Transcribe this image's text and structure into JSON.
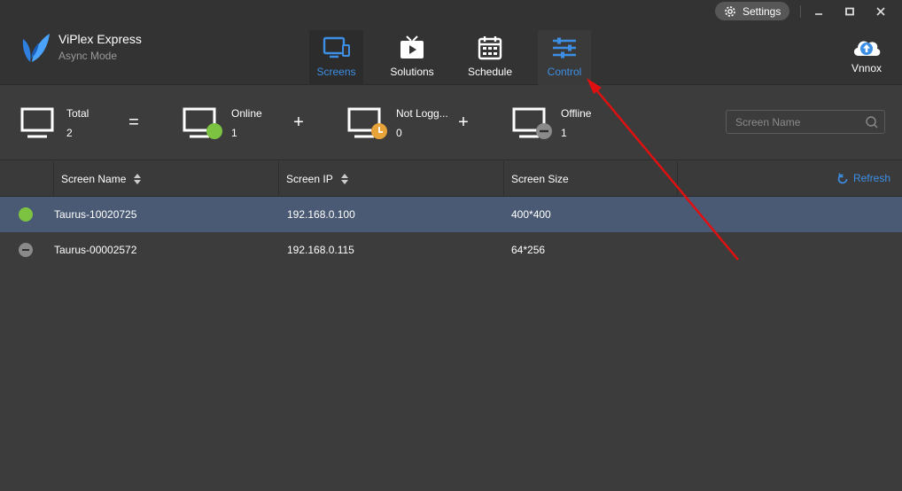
{
  "app": {
    "title": "ViPlex Express",
    "mode": "Async Mode"
  },
  "window": {
    "settings_label": "Settings"
  },
  "nav": {
    "screens": "Screens",
    "solutions": "Solutions",
    "schedule": "Schedule",
    "control": "Control"
  },
  "user": {
    "name": "Vnnox"
  },
  "stats": {
    "total": {
      "label": "Total",
      "value": "2"
    },
    "online": {
      "label": "Online",
      "value": "1"
    },
    "not_logged": {
      "label": "Not Logg...",
      "value": "0"
    },
    "offline": {
      "label": "Offline",
      "value": "1"
    },
    "op_equals": "=",
    "op_plus_1": "+",
    "op_plus_2": "+"
  },
  "search": {
    "placeholder": "Screen Name",
    "value": ""
  },
  "table": {
    "columns": {
      "name": "Screen Name",
      "ip": "Screen IP",
      "size": "Screen Size"
    },
    "refresh_label": "Refresh",
    "rows": [
      {
        "status": "online",
        "name": "Taurus-10020725",
        "ip": "192.168.0.100",
        "size": "400*400",
        "selected": true
      },
      {
        "status": "offline",
        "name": "Taurus-00002572",
        "ip": "192.168.0.115",
        "size": "64*256",
        "selected": false
      }
    ]
  },
  "colors": {
    "accent": "#3d8fe6",
    "online": "#7cc342",
    "not_logged": "#e8a23a",
    "offline": "#8a8a8a",
    "selected_row": "#4a5a74",
    "annotation_arrow": "#e01010"
  },
  "icons": {
    "logo": "viplex-logo-icon",
    "screens": "monitor-phone-icon",
    "solutions": "play-tv-icon",
    "schedule": "calendar-icon",
    "control": "sliders-icon",
    "user": "cloud-upload-icon",
    "settings": "gear-icon"
  }
}
